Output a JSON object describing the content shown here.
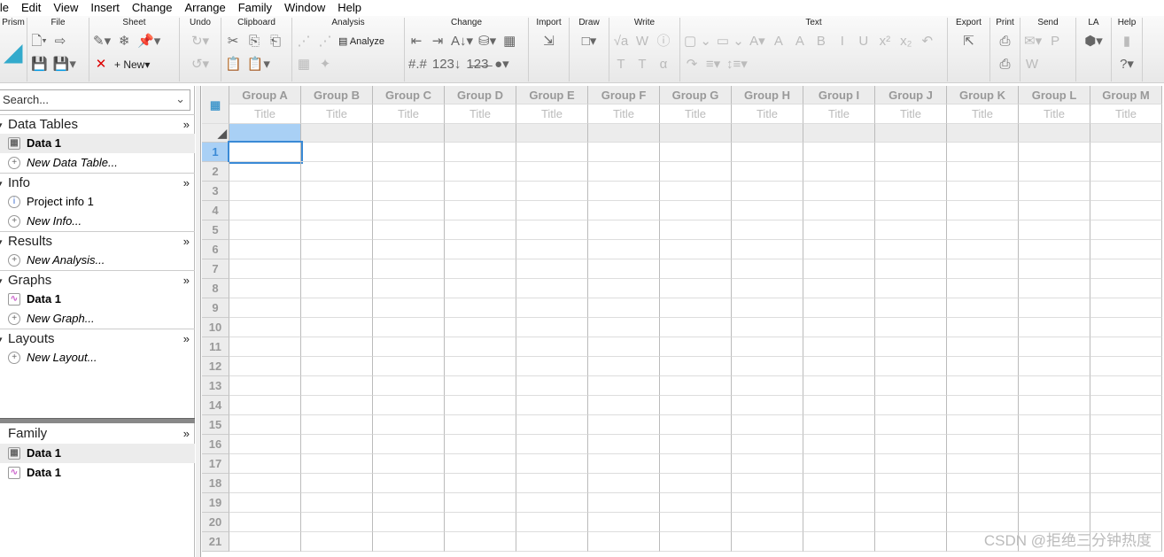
{
  "menu": [
    "ile",
    "Edit",
    "View",
    "Insert",
    "Change",
    "Arrange",
    "Family",
    "Window",
    "Help"
  ],
  "ribbon": [
    {
      "label": "Prism",
      "w": 31,
      "icons": [
        [
          "prism-logo-icon",
          "◢"
        ]
      ]
    },
    {
      "label": "File",
      "w": 70,
      "icons": [
        [
          "new-file-icon",
          "🗋▾"
        ],
        [
          "open-file-icon",
          "⇨"
        ],
        [
          "save-icon",
          "💾"
        ],
        [
          "save-as-icon",
          "💾▾"
        ]
      ]
    },
    {
      "label": "Sheet",
      "w": 102,
      "icons": [
        [
          "highlight-icon",
          "✎▾"
        ],
        [
          "freeze-icon",
          "❄"
        ],
        [
          "pin-icon",
          "📌▾"
        ],
        [
          "delete-icon",
          "✕"
        ],
        [
          "new-sheet-icon",
          "+ New▾"
        ]
      ]
    },
    {
      "label": "Undo",
      "w": 47,
      "icons": [
        [
          "redo-icon",
          "↻▾"
        ],
        [
          "undo-icon",
          "↺▾"
        ]
      ]
    },
    {
      "label": "Clipboard",
      "w": 80,
      "icons": [
        [
          "cut-icon",
          "✂"
        ],
        [
          "copy-icon",
          "⎘"
        ],
        [
          "paste-special-icon",
          "⎗"
        ],
        [
          "paste-icon",
          "📋"
        ],
        [
          "paste-menu-icon",
          "📋▾"
        ]
      ]
    },
    {
      "label": "Analysis",
      "w": 127,
      "icons": [
        [
          "analysis-chart-icon",
          "⋰"
        ],
        [
          "analysis-chart2-icon",
          "⋰"
        ],
        [
          "analyze-button",
          "▤ Analyze"
        ],
        [
          "table-icon",
          "▦"
        ],
        [
          "wand-icon",
          "✦"
        ]
      ]
    },
    {
      "label": "Change",
      "w": 140,
      "icons": [
        [
          "insert-left-icon",
          "⇤"
        ],
        [
          "insert-right-icon",
          "⇥"
        ],
        [
          "sort-icon",
          "A↓▾"
        ],
        [
          "fill-icon",
          "⛁▾"
        ],
        [
          "table-format-icon",
          "▦"
        ],
        [
          "number-format-icon",
          "#.#"
        ],
        [
          "decimal-icon",
          "123↓"
        ],
        [
          "strike-icon",
          "1̶2̶3̶"
        ],
        [
          "color-icon",
          "●▾"
        ]
      ]
    },
    {
      "label": "Import",
      "w": 46,
      "icons": [
        [
          "import-icon",
          "⇲"
        ]
      ]
    },
    {
      "label": "Draw",
      "w": 45,
      "icons": [
        [
          "draw-shape-icon",
          "□▾"
        ]
      ]
    },
    {
      "label": "Write",
      "w": 80,
      "icons": [
        [
          "sqrt-icon",
          "√a"
        ],
        [
          "word-icon",
          "W"
        ],
        [
          "info-icon",
          "ⓘ"
        ],
        [
          "text-t-icon",
          "T"
        ],
        [
          "text-box-icon",
          "T"
        ],
        [
          "alpha-icon",
          "α"
        ]
      ]
    },
    {
      "label": "Text",
      "w": 302,
      "icons": [
        [
          "font-size-select",
          "▢ ⌄"
        ],
        [
          "font-select",
          "▭ ⌄"
        ],
        [
          "font-color-icon",
          "A▾"
        ],
        [
          "grow-font-icon",
          "A"
        ],
        [
          "shrink-font-icon",
          "A"
        ],
        [
          "bold-icon",
          "B"
        ],
        [
          "italic-icon",
          "I"
        ],
        [
          "underline-icon",
          "U"
        ],
        [
          "superscript-icon",
          "x²"
        ],
        [
          "subscript-icon",
          "x₂"
        ],
        [
          "rotate-left-icon",
          "↶"
        ],
        [
          "rotate-right-icon",
          "↷"
        ],
        [
          "align-icon",
          "≡▾"
        ],
        [
          "spacing-icon",
          "↕≡▾"
        ]
      ]
    },
    {
      "label": "Export",
      "w": 48,
      "icons": [
        [
          "export-icon",
          "⇱"
        ]
      ]
    },
    {
      "label": "Print",
      "w": 34,
      "icons": [
        [
          "print-icon",
          "⎙"
        ],
        [
          "print-preview-icon",
          "⎙"
        ]
      ]
    },
    {
      "label": "Send",
      "w": 63,
      "icons": [
        [
          "mail-icon",
          "✉▾"
        ],
        [
          "powerpoint-icon",
          "P"
        ],
        [
          "word-send-icon",
          "W"
        ]
      ]
    },
    {
      "label": "LA",
      "w": 40,
      "icons": [
        [
          "la-icon",
          "⬢▾"
        ]
      ]
    },
    {
      "label": "Help",
      "w": 35,
      "icons": [
        [
          "help-book-icon",
          "▮"
        ],
        [
          "help-icon",
          "?▾"
        ]
      ]
    }
  ],
  "sidebar": {
    "search_placeholder": "Search...",
    "sections": [
      {
        "title": "Data Tables",
        "items": [
          {
            "label": "Data 1",
            "icon": "table",
            "sel": true,
            "bold": true
          },
          {
            "label": "New Data Table...",
            "icon": "plus",
            "italic": true
          }
        ]
      },
      {
        "title": "Info",
        "items": [
          {
            "label": "Project info 1",
            "icon": "info"
          },
          {
            "label": "New Info...",
            "icon": "plus",
            "italic": true
          }
        ]
      },
      {
        "title": "Results",
        "items": [
          {
            "label": "New Analysis...",
            "icon": "plus",
            "italic": true
          }
        ]
      },
      {
        "title": "Graphs",
        "items": [
          {
            "label": "Data 1",
            "icon": "graph",
            "bold": true
          },
          {
            "label": "New Graph...",
            "icon": "plus",
            "italic": true
          }
        ]
      },
      {
        "title": "Layouts",
        "items": [
          {
            "label": "New Layout...",
            "icon": "plus",
            "italic": true
          }
        ]
      }
    ],
    "family": {
      "title": "Family",
      "items": [
        {
          "label": "Data 1",
          "icon": "table",
          "sel": true,
          "bold": true
        },
        {
          "label": "Data 1",
          "icon": "graph",
          "bold": true
        }
      ]
    }
  },
  "grid": {
    "columns": [
      "Group A",
      "Group B",
      "Group C",
      "Group D",
      "Group E",
      "Group F",
      "Group G",
      "Group H",
      "Group I",
      "Group J",
      "Group K",
      "Group L",
      "Group M"
    ],
    "subtitle": "Title",
    "rows": [
      "1",
      "2",
      "3",
      "4",
      "5",
      "6",
      "7",
      "8",
      "9",
      "10",
      "11",
      "12",
      "13",
      "14",
      "15",
      "16",
      "17",
      "18",
      "19",
      "20",
      "21"
    ],
    "selected_color": "#a9d0f5",
    "accent": "#3a8ad6"
  },
  "watermark": "CSDN @拒绝三分钟热度"
}
